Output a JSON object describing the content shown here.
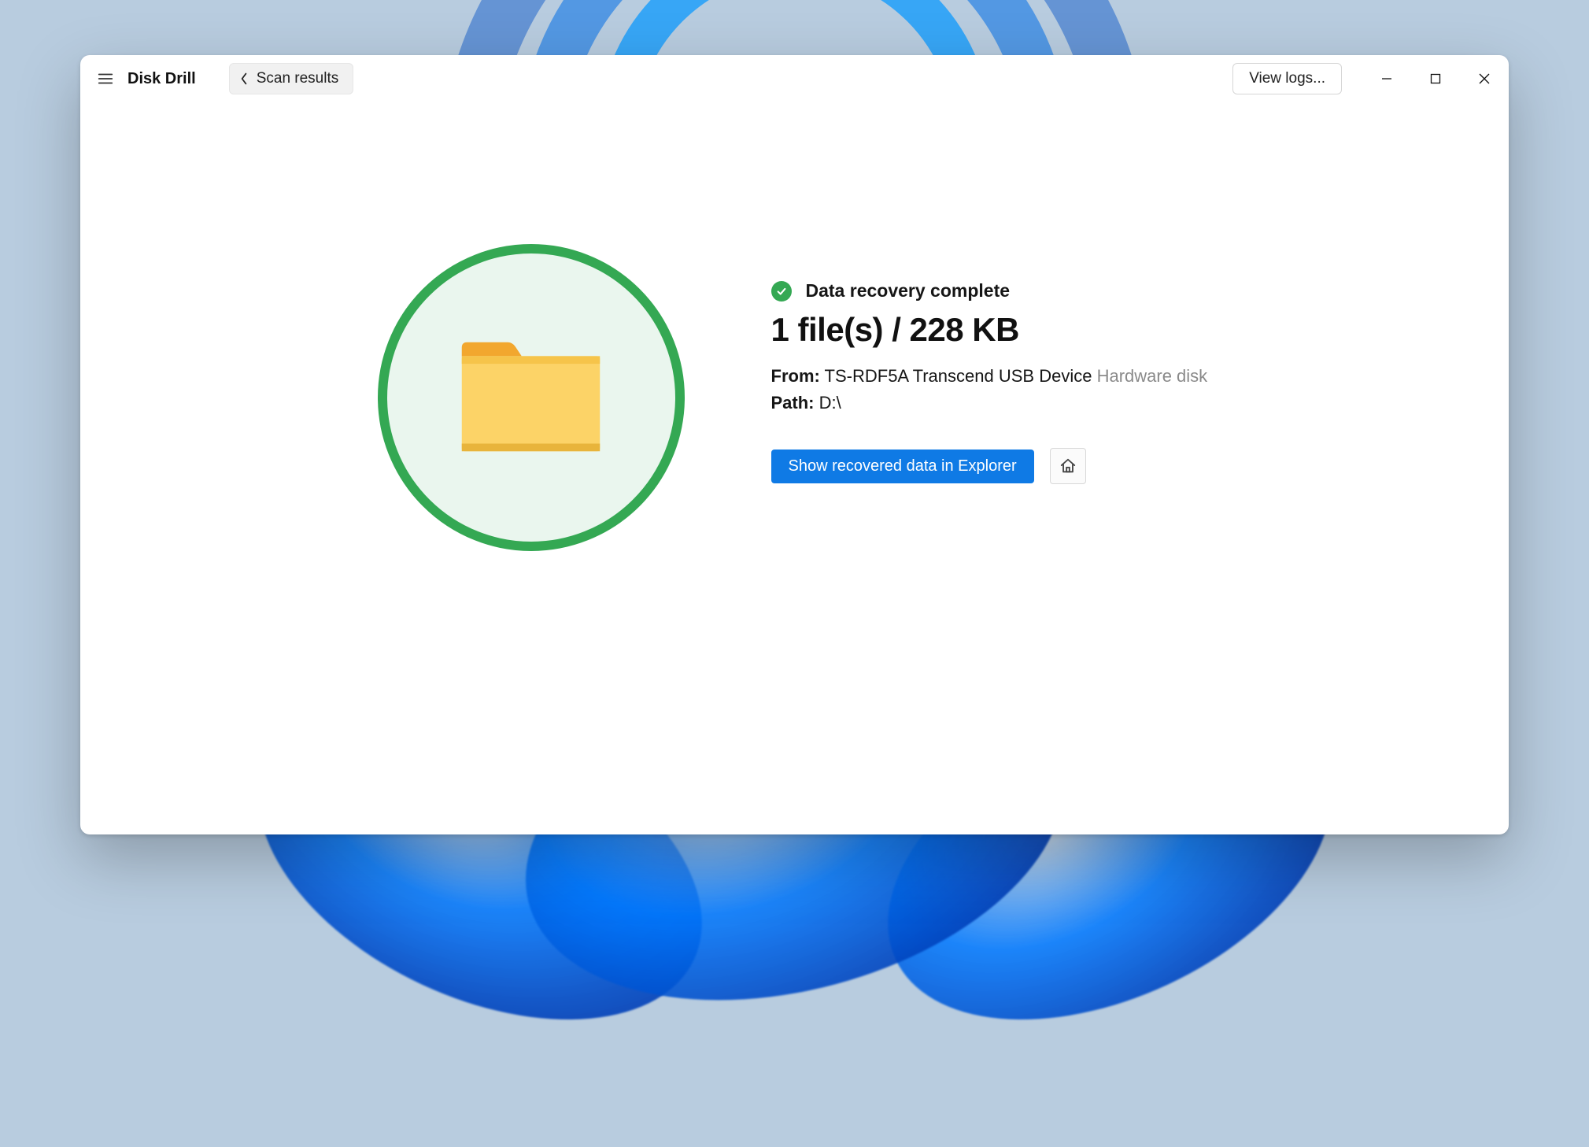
{
  "header": {
    "app_title": "Disk Drill",
    "back_label": "Scan results",
    "view_logs_label": "View logs..."
  },
  "result": {
    "status_text": "Data recovery complete",
    "headline": "1 file(s) / 228 KB",
    "from_label": "From:",
    "from_device": "TS-RDF5A Transcend USB Device",
    "from_type": "Hardware disk",
    "path_label": "Path:",
    "path_value": "D:\\",
    "primary_action": "Show recovered data in Explorer"
  }
}
